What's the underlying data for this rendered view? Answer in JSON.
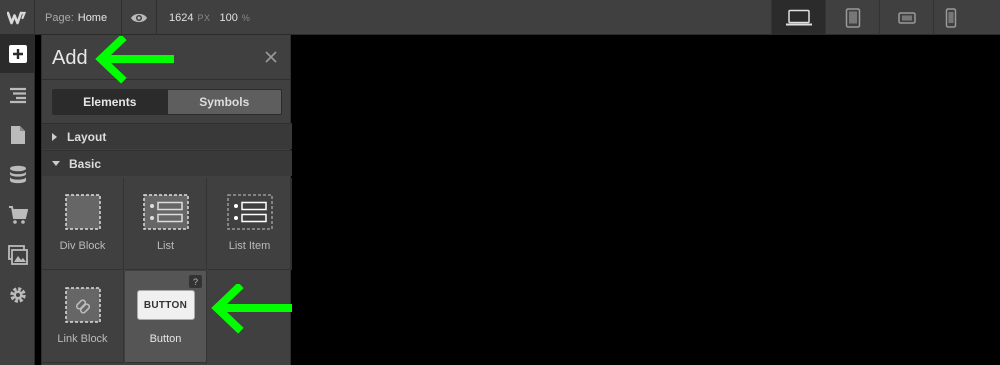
{
  "topbar": {
    "page_label": "Page:",
    "page_name": "Home",
    "width_value": "1624",
    "width_unit": "PX",
    "zoom_value": "100",
    "zoom_unit": "%",
    "devices": [
      "desktop-icon",
      "tablet-icon",
      "mobile-landscape-icon",
      "mobile-portrait-icon"
    ],
    "active_device": "desktop"
  },
  "rail": {
    "items": [
      "add-icon",
      "navigator-icon",
      "pages-icon",
      "cms-icon",
      "ecommerce-icon",
      "assets-icon",
      "settings-icon"
    ],
    "active": "add"
  },
  "panel": {
    "title": "Add",
    "tabs": [
      {
        "label": "Elements",
        "active": true
      },
      {
        "label": "Symbols",
        "active": false
      }
    ],
    "sections": [
      {
        "label": "Layout",
        "expanded": false
      },
      {
        "label": "Basic",
        "expanded": true
      }
    ],
    "elements": [
      {
        "label": "Div Block",
        "icon": "div-block-icon"
      },
      {
        "label": "List",
        "icon": "list-icon"
      },
      {
        "label": "List Item",
        "icon": "list-item-icon"
      },
      {
        "label": "Link Block",
        "icon": "link-block-icon"
      },
      {
        "label": "Button",
        "icon": "button-icon",
        "preview_text": "BUTTON",
        "help": "?"
      }
    ]
  },
  "annotations": {
    "arrow_color": "#00ff00"
  }
}
